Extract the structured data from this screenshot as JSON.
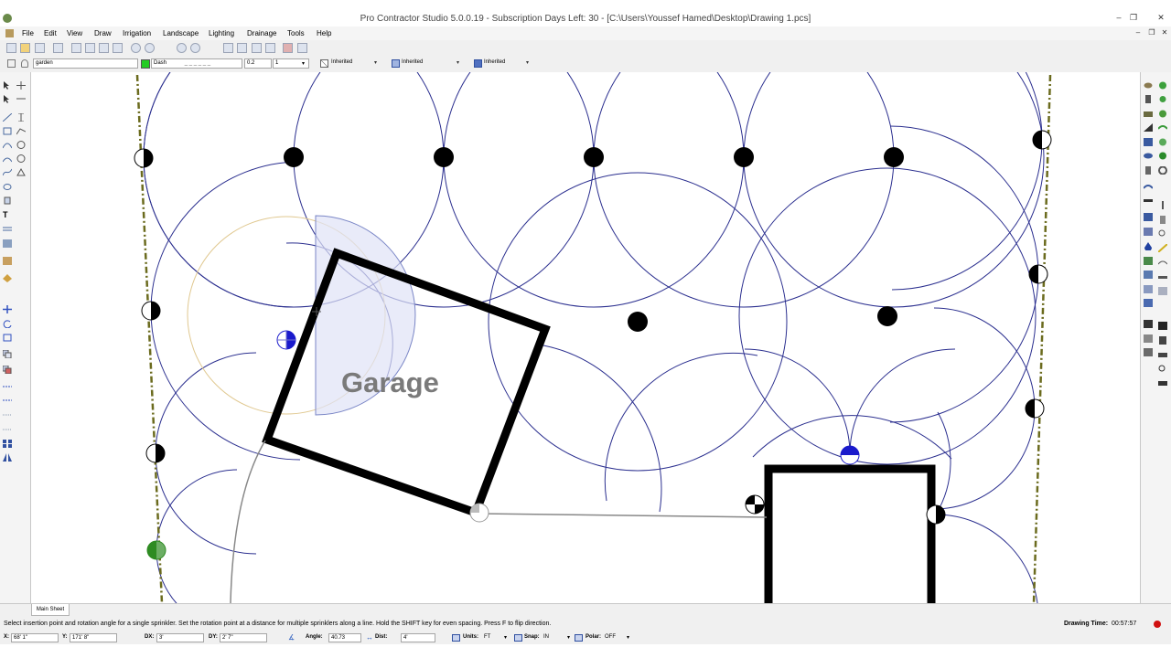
{
  "window": {
    "title": "Pro Contractor Studio 5.0.0.19 - Subscription Days Left: 30 - [C:\\Users\\Youssef Hamed\\Desktop\\Drawing 1.pcs]",
    "controls": {
      "minimize": "–",
      "maximize": "❐",
      "close": "✕"
    },
    "mdi_controls": {
      "minimize": "–",
      "restore": "❐",
      "close": "✕"
    }
  },
  "menu": [
    "File",
    "Edit",
    "View",
    "Draw",
    "Irrigation",
    "Landscape",
    "Lighting",
    "Drainage",
    "Tools",
    "Help"
  ],
  "properties_bar": {
    "layer": "garden",
    "layer_color": "#22cc22",
    "linetype": "Dash",
    "linetype_sample": "_ _ _ _ _ _",
    "line_scale": "0.2",
    "line_weight": "1",
    "color_value": "Inherited",
    "linetype_value": "Inherited",
    "lineweight_value": "Inherited"
  },
  "canvas": {
    "garage_label": "Garage"
  },
  "sheets": {
    "active_tab": "Main Sheet"
  },
  "status": {
    "message": "Select insertion point and rotation angle for a single sprinkler. Set the rotation point at a distance for multiple sprinklers along a line.  Hold the SHIFT key for even spacing. Press F to flip direction.",
    "drawing_time_label": "Drawing Time:",
    "drawing_time": "00:57:57"
  },
  "coords": {
    "x_label": "X:",
    "x_value": "68' 1\"",
    "y_label": "Y:",
    "y_value": "171' 8\"",
    "dx_label": "DX:",
    "dx_value": "3'",
    "dy_label": "DY:",
    "dy_value": "2' 7\"",
    "angle_label": "Angle:",
    "angle_value": "40.73",
    "dist_label": "Dist:",
    "dist_value": "4'",
    "units_label": "Units:",
    "units_value": "FT",
    "snap_label": "Snap:",
    "snap_value": "IN",
    "polar_label": "Polar:",
    "polar_value": "OFF"
  },
  "colors": {
    "spray_circle": "#2b2f8f",
    "selected_head": "#1a1acc",
    "green_head": "#2e8b22",
    "property_line": "#6b6b1e",
    "building_wall": "#000000",
    "arc_preview": "#e0c890",
    "arc_fill": "#dfe3f7"
  }
}
